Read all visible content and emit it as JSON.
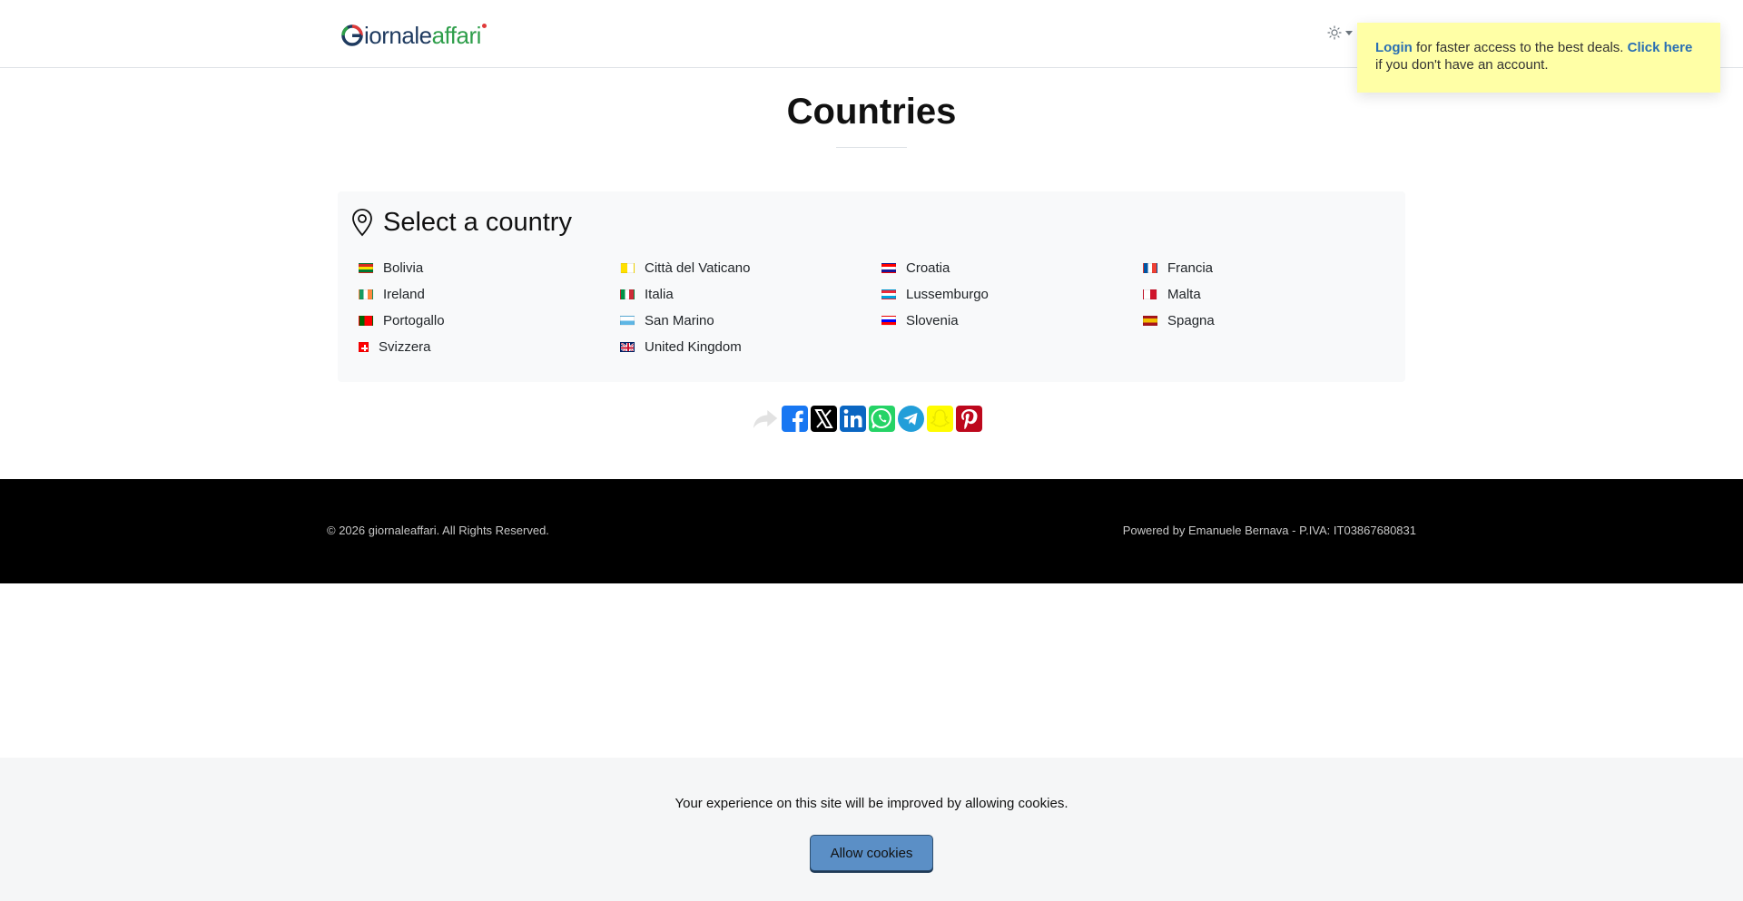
{
  "header": {
    "logo": {
      "g": "G",
      "dark": "iornale",
      "green": "affari"
    },
    "theme_icon": "sun-icon"
  },
  "toast": {
    "login_link": "Login",
    "text_1": " for faster access to the best deals. ",
    "click_link": "Click here",
    "text_2": " if you don't have an account."
  },
  "page": {
    "title": "Countries"
  },
  "card": {
    "icon": "map-pin-icon",
    "title": "Select a country",
    "countries": [
      {
        "name": "Bolivia",
        "flag": "bolivia"
      },
      {
        "name": "Città del Vaticano",
        "flag": "vatican"
      },
      {
        "name": "Croatia",
        "flag": "croatia"
      },
      {
        "name": "Francia",
        "flag": "france"
      },
      {
        "name": "Ireland",
        "flag": "ireland"
      },
      {
        "name": "Italia",
        "flag": "italy"
      },
      {
        "name": "Lussemburgo",
        "flag": "luxembourg"
      },
      {
        "name": "Malta",
        "flag": "malta"
      },
      {
        "name": "Portogallo",
        "flag": "portugal"
      },
      {
        "name": "San Marino",
        "flag": "san-marino"
      },
      {
        "name": "Slovenia",
        "flag": "slovenia"
      },
      {
        "name": "Spagna",
        "flag": "spain"
      },
      {
        "name": "Svizzera",
        "flag": "switzerland"
      },
      {
        "name": "United Kingdom",
        "flag": "uk"
      }
    ]
  },
  "share": {
    "buttons": [
      "share-icon",
      "facebook-icon",
      "x-icon",
      "linkedin-icon",
      "whatsapp-icon",
      "telegram-icon",
      "snapchat-icon",
      "pinterest-icon"
    ],
    "colors": {
      "share": "#e5e5e5",
      "facebook": "#1877f2",
      "x": "#000000",
      "linkedin": "#0a66c2",
      "whatsapp": "#25d366",
      "telegram": "#229ed9",
      "snapchat": "#fffc00",
      "pinterest": "#bd081c"
    }
  },
  "footer": {
    "copyright": "© 2026 giornaleaffari. All Rights Reserved.",
    "powered": "Powered by Emanuele Bernava - P.IVA: IT03867680831"
  },
  "cookie": {
    "text": "Your experience on this site will be improved by allowing cookies.",
    "button": "Allow cookies"
  }
}
